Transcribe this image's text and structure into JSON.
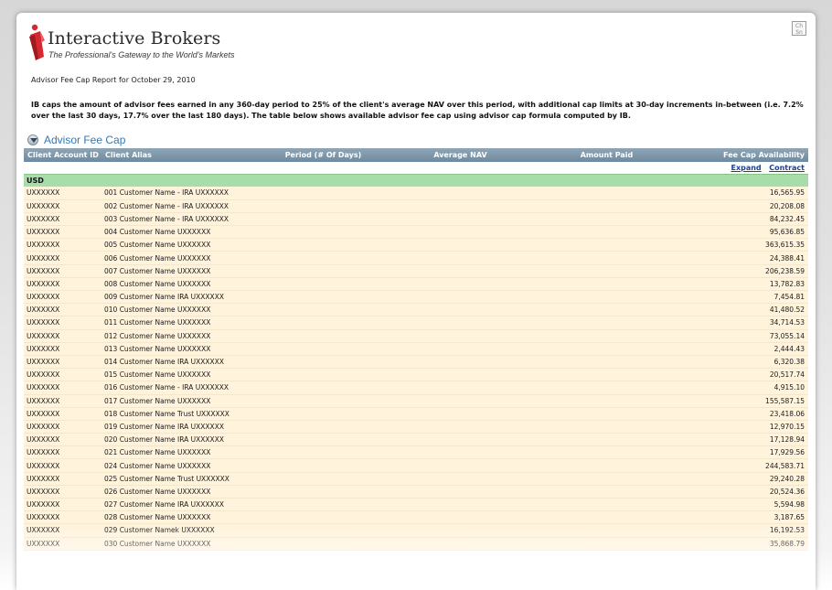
{
  "header": {
    "logo_name": "Interactive Brokers",
    "logo_tagline": "The Professional's Gateway to the World's Markets",
    "corner_icon": "restore-icon",
    "corner_text": "Ch\nSn"
  },
  "report": {
    "title": "Advisor Fee Cap Report for October 29, 2010",
    "description": "IB caps the amount of advisor fees earned in any 360-day period to 25% of the client's average NAV over this period, with additional cap limits at 30-day increments in-between (i.e. 7.2% over the last 30 days, 17.7% over the last 180 days). The table below shows available advisor fee cap using advisor cap formula computed by IB."
  },
  "section": {
    "title": "Advisor Fee Cap",
    "icon": "collapse-arrow-icon"
  },
  "table": {
    "columns": [
      "Client Account ID",
      "Client Alias",
      "Period (# Of Days)",
      "Average NAV",
      "Amount Paid",
      "Fee Cap Availability"
    ],
    "expand_label": "Expand",
    "contract_label": "Contract",
    "currency": "USD",
    "rows": [
      {
        "id": "UXXXXXX",
        "alias": "001 Customer Name - IRA UXXXXXX",
        "cap": "16,565.95"
      },
      {
        "id": "UXXXXXX",
        "alias": "002 Customer Name - IRA UXXXXXX",
        "cap": "20,208.08"
      },
      {
        "id": "UXXXXXX",
        "alias": "003 Customer Name - IRA UXXXXXX",
        "cap": "84,232.45"
      },
      {
        "id": "UXXXXXX",
        "alias": "004 Customer Name UXXXXXX",
        "cap": "95,636.85"
      },
      {
        "id": "UXXXXXX",
        "alias": "005 Customer Name UXXXXXX",
        "cap": "363,615.35"
      },
      {
        "id": "UXXXXXX",
        "alias": "006 Customer Name UXXXXXX",
        "cap": "24,388.41"
      },
      {
        "id": "UXXXXXX",
        "alias": "007 Customer Name UXXXXXX",
        "cap": "206,238.59"
      },
      {
        "id": "UXXXXXX",
        "alias": "008 Customer Name UXXXXXX",
        "cap": "13,782.83"
      },
      {
        "id": "UXXXXXX",
        "alias": "009 Customer Name IRA UXXXXXX",
        "cap": "7,454.81"
      },
      {
        "id": "UXXXXXX",
        "alias": "010 Customer Name UXXXXXX",
        "cap": "41,480.52"
      },
      {
        "id": "UXXXXXX",
        "alias": "011 Customer Name UXXXXXX",
        "cap": "34,714.53"
      },
      {
        "id": "UXXXXXX",
        "alias": "012 Customer Name UXXXXXX",
        "cap": "73,055.14"
      },
      {
        "id": "UXXXXXX",
        "alias": "013 Customer Name UXXXXXX",
        "cap": "2,444.43"
      },
      {
        "id": "UXXXXXX",
        "alias": "014 Customer Name IRA UXXXXXX",
        "cap": "6,320.38"
      },
      {
        "id": "UXXXXXX",
        "alias": "015 Customer Name UXXXXXX",
        "cap": "20,517.74"
      },
      {
        "id": "UXXXXXX",
        "alias": "016 Customer Name - IRA UXXXXXX",
        "cap": "4,915.10"
      },
      {
        "id": "UXXXXXX",
        "alias": "017 Customer Name UXXXXXX",
        "cap": "155,587.15"
      },
      {
        "id": "UXXXXXX",
        "alias": "018 Customer Name Trust UXXXXXX",
        "cap": "23,418.06"
      },
      {
        "id": "UXXXXXX",
        "alias": "019 Customer Name IRA UXXXXXX",
        "cap": "12,970.15"
      },
      {
        "id": "UXXXXXX",
        "alias": "020 Customer Name IRA UXXXXXX",
        "cap": "17,128.94"
      },
      {
        "id": "UXXXXXX",
        "alias": "021 Customer Name UXXXXXX",
        "cap": "17,929.56"
      },
      {
        "id": "UXXXXXX",
        "alias": "024 Customer Name UXXXXXX",
        "cap": "244,583.71"
      },
      {
        "id": "UXXXXXX",
        "alias": "025 Customer Name Trust UXXXXXX",
        "cap": "29,240.28"
      },
      {
        "id": "UXXXXXX",
        "alias": "026 Customer Name UXXXXXX",
        "cap": "20,524.36"
      },
      {
        "id": "UXXXXXX",
        "alias": "027 Customer Name IRA UXXXXXX",
        "cap": "5,594.98"
      },
      {
        "id": "UXXXXXX",
        "alias": "028 Customer Name UXXXXXX",
        "cap": "3,187.65"
      },
      {
        "id": "UXXXXXX",
        "alias": "029 Customer Namek UXXXXXX",
        "cap": "16,192.53"
      },
      {
        "id": "UXXXXXX",
        "alias": "030 Customer Name UXXXXXX",
        "cap": "35,868.79"
      }
    ]
  },
  "colors": {
    "header_bar": "#7a94a8",
    "currency_row": "#a8dcaa",
    "data_row": "#fff3dc",
    "section_title": "#2f7ab8",
    "logo_red": "#d7282f"
  }
}
